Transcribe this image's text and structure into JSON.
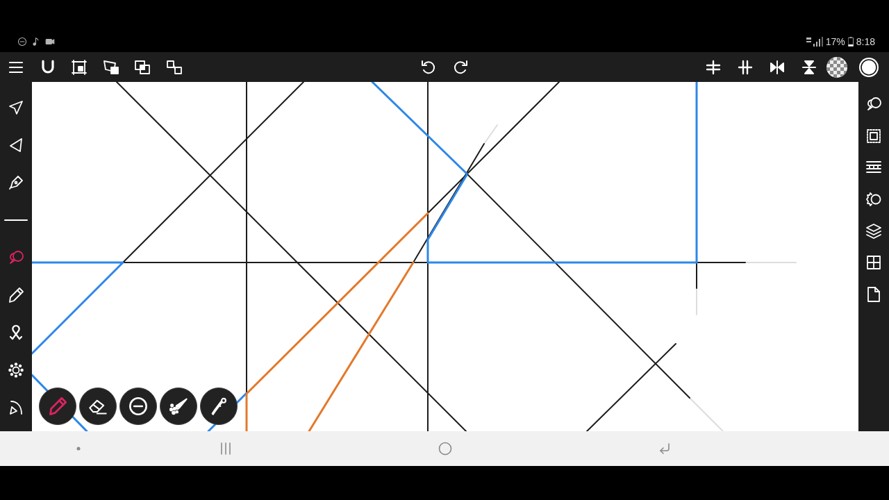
{
  "status_bar": {
    "battery": "17%",
    "time": "8:18"
  },
  "tools": [
    {
      "selected": false
    },
    {
      "selected": false
    },
    {
      "selected": false
    },
    {
      "selected": false
    },
    {
      "selected": true
    },
    {
      "selected": false
    },
    {
      "selected": false
    },
    {
      "selected": false
    },
    {
      "selected": false
    }
  ],
  "brushes": [
    {
      "selected": true
    },
    {
      "selected": false
    },
    {
      "selected": false
    },
    {
      "selected": false
    },
    {
      "selected": false
    }
  ]
}
